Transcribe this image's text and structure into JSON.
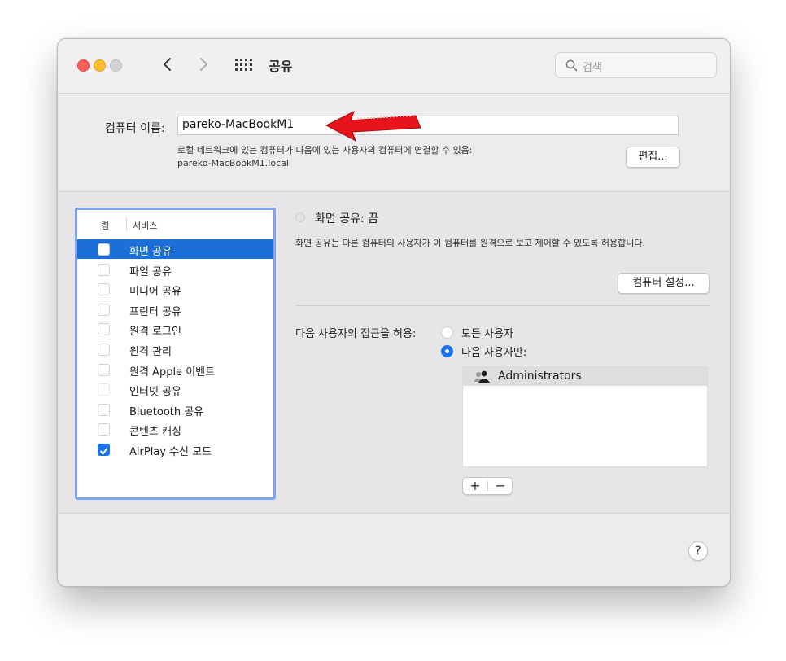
{
  "window": {
    "title": "공유",
    "search_placeholder": "검색"
  },
  "computer_name": {
    "label": "컴퓨터 이름:",
    "value": "pareko-MacBookM1",
    "description_line1": "로컬 네트워크에 있는 컴퓨터가 다음에 있는 사용자의 컴퓨터에 연결할 수 있음:",
    "description_line2": "pareko-MacBookM1.local",
    "edit_button": "편집..."
  },
  "services": {
    "header_on": "켬",
    "header_service": "서비스",
    "items": [
      {
        "label": "화면 공유",
        "checked": false,
        "selected": true
      },
      {
        "label": "파일 공유",
        "checked": false,
        "selected": false
      },
      {
        "label": "미디어 공유",
        "checked": false,
        "selected": false
      },
      {
        "label": "프린터 공유",
        "checked": false,
        "selected": false
      },
      {
        "label": "원격 로그인",
        "checked": false,
        "selected": false
      },
      {
        "label": "원격 관리",
        "checked": false,
        "selected": false
      },
      {
        "label": "원격 Apple 이벤트",
        "checked": false,
        "selected": false
      },
      {
        "label": "인터넷 공유",
        "checked": false,
        "selected": false
      },
      {
        "label": "Bluetooth 공유",
        "checked": false,
        "selected": false
      },
      {
        "label": "콘텐츠 캐싱",
        "checked": false,
        "selected": false
      },
      {
        "label": "AirPlay 수신 모드",
        "checked": true,
        "selected": false
      }
    ]
  },
  "detail": {
    "status": "화면 공유: 끔",
    "description": "화면 공유는 다른 컴퓨터의 사용자가 이 컴퓨터를 원격으로 보고 제어할 수 있도록 허용합니다.",
    "computer_settings_button": "컴퓨터 설정...",
    "access_label": "다음 사용자의 접근을 허용:",
    "option_all": "모든 사용자",
    "option_only": "다음 사용자만:",
    "selected_option": "only",
    "users": [
      "Administrators"
    ],
    "add_button": "+",
    "remove_button": "−"
  },
  "help_button": "?",
  "colors": {
    "selection": "#1c6fd6",
    "accent": "#1a73e8",
    "list_border": "#7da4ec",
    "arrow": "#e8141b"
  }
}
